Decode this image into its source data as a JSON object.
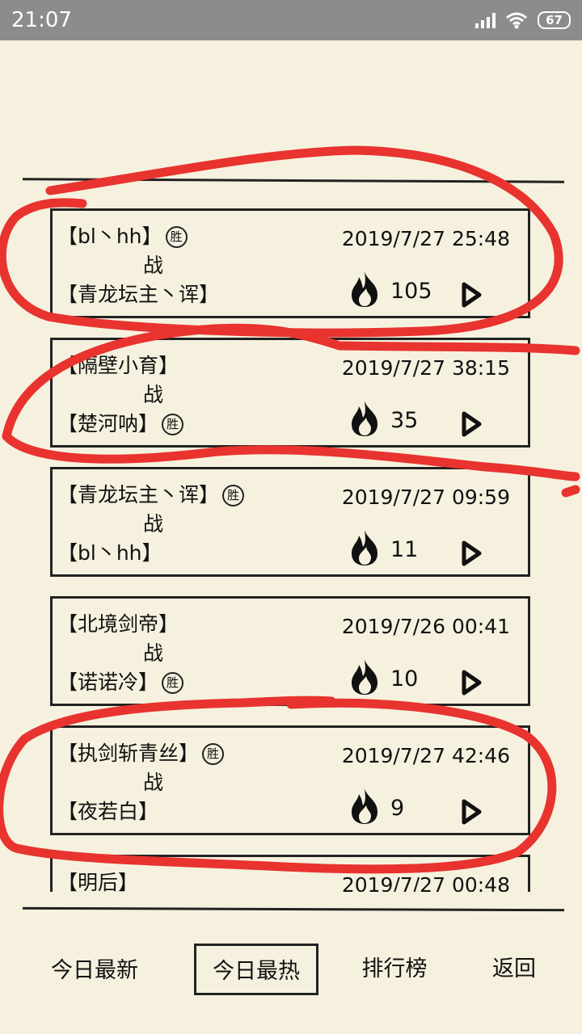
{
  "status": {
    "time": "21:07",
    "battery": "67"
  },
  "battle_label": "战",
  "win_label": "胜",
  "records": [
    {
      "p1": "【bl丶hh】",
      "p1_win": true,
      "p2": "【青龙坛主丶诨】",
      "p2_win": false,
      "date": "2019/7/27 25:48",
      "heat": "105"
    },
    {
      "p1": "【隔壁小育】",
      "p1_win": false,
      "p2": "【楚河呐】",
      "p2_win": true,
      "date": "2019/7/27 38:15",
      "heat": "35"
    },
    {
      "p1": "【青龙坛主丶诨】",
      "p1_win": true,
      "p2": "【bl丶hh】",
      "p2_win": false,
      "date": "2019/7/27 09:59",
      "heat": "11"
    },
    {
      "p1": "【北境剑帝】",
      "p1_win": false,
      "p2": "【诺诺冷】",
      "p2_win": true,
      "date": "2019/7/26 00:41",
      "heat": "10"
    },
    {
      "p1": "【执剑斩青丝】",
      "p1_win": true,
      "p2": "【夜若白】",
      "p2_win": false,
      "date": "2019/7/27 42:46",
      "heat": "9"
    },
    {
      "p1": "【明后】",
      "p1_win": false,
      "p2": "",
      "p2_win": false,
      "date": "2019/7/27 00:48",
      "heat": ""
    }
  ],
  "nav": {
    "latest": "今日最新",
    "hottest": "今日最热",
    "ranking": "排行榜",
    "back": "返回"
  },
  "annotation_color": "#e8332f"
}
